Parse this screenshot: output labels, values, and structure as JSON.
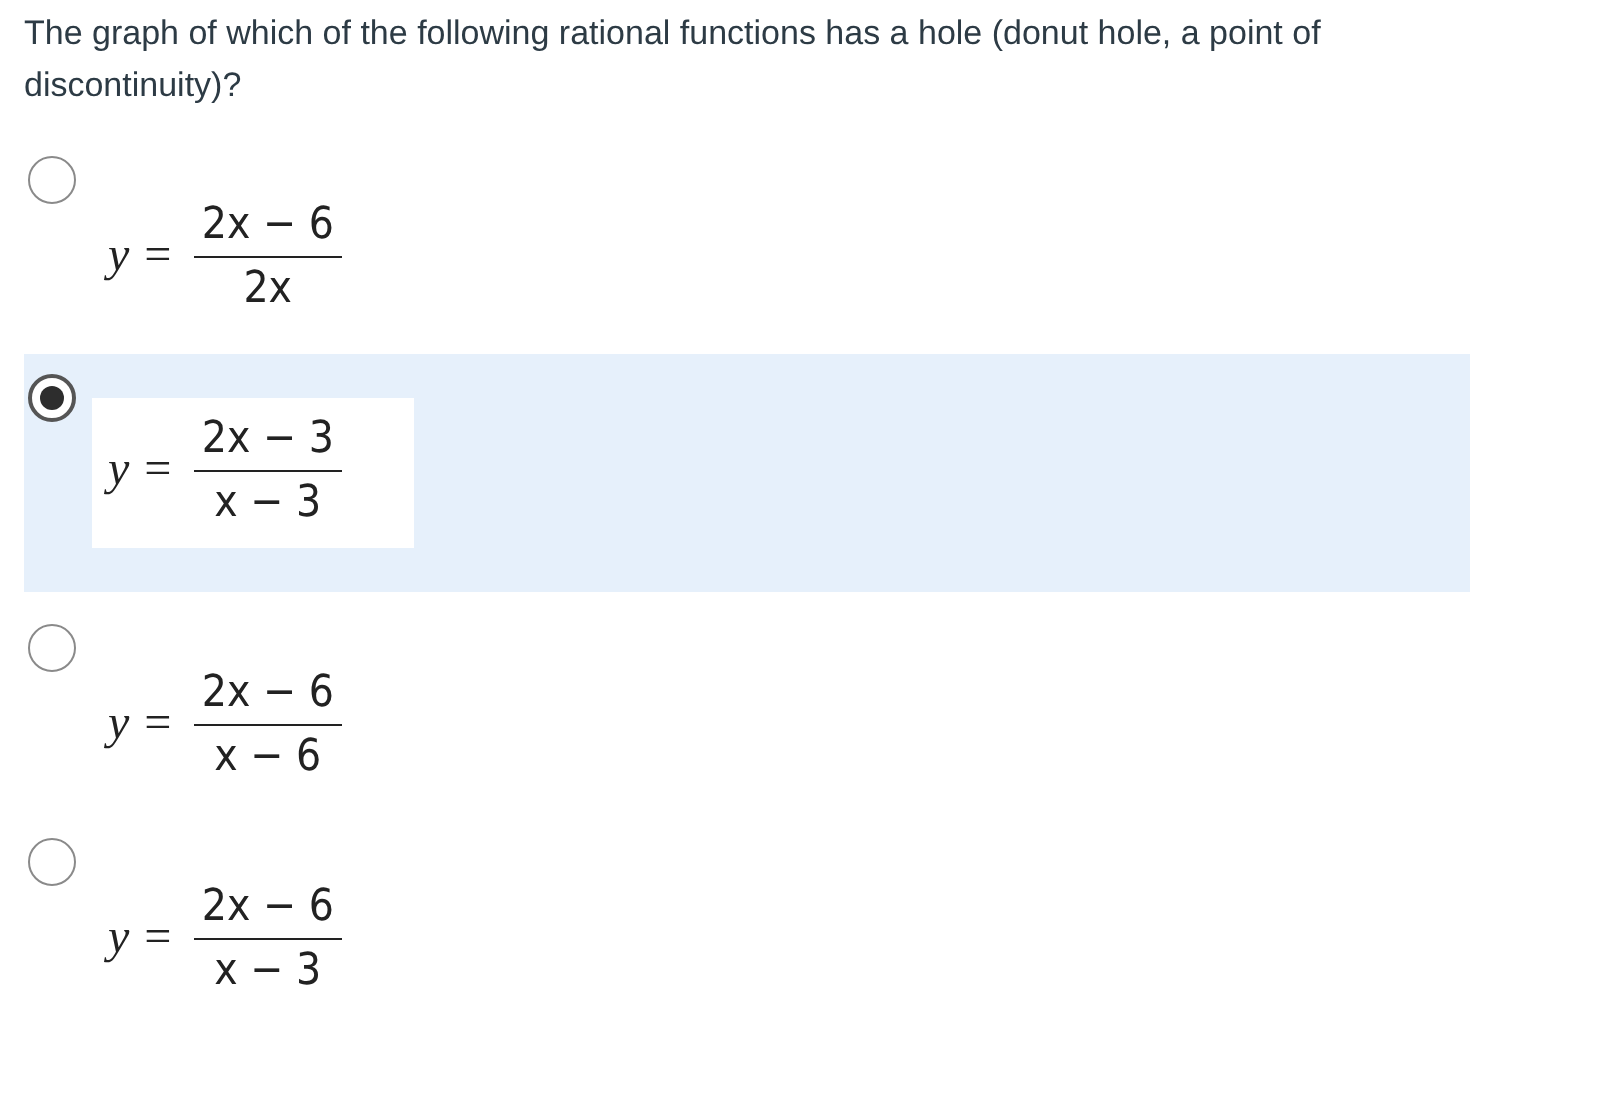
{
  "question": "The graph of which of the following rational functions has a hole (donut hole, a point of discontinuity)?",
  "options": [
    {
      "lhs": "y =",
      "numerator": "2x − 6",
      "denominator": "2x",
      "selected": false
    },
    {
      "lhs": "y =",
      "numerator": "2x − 3",
      "denominator": "x − 3",
      "selected": true
    },
    {
      "lhs": "y =",
      "numerator": "2x − 6",
      "denominator": "x − 6",
      "selected": false
    },
    {
      "lhs": "y =",
      "numerator": "2x − 6",
      "denominator": "x − 3",
      "selected": false
    }
  ]
}
